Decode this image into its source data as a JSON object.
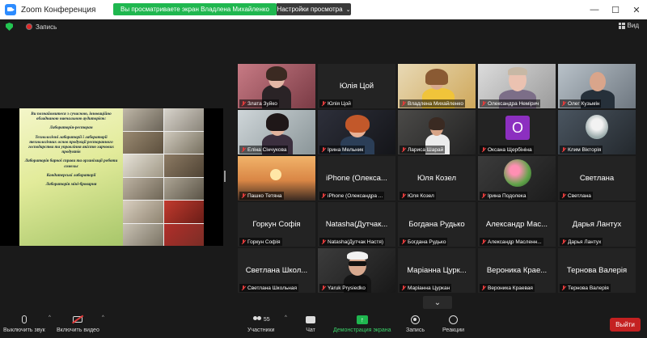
{
  "window": {
    "title": "Zoom Конференция",
    "banner": "Вы просматриваете экран Владлена Михайленко",
    "view_options": "Настройки просмотра",
    "minimize": "—",
    "maximize": "☐",
    "close": "✕"
  },
  "status": {
    "recording": "Запись",
    "view": "Вид"
  },
  "slide": {
    "lines": [
      "Ви познайомитеся з сучасною, інноваційно обладнаною навчальною аудиторією:",
      "Лабораторія-ресторан",
      "Технологічні лабораторії і лабораторії технологічних основ продукції ресторанного господарства та управління якістю харчових продуктів",
      "Лабораторія барної справи та організації роботи сомельє",
      "Кондитерські лабораторії",
      "Лабораторія міні-броварня"
    ]
  },
  "participants": [
    {
      "label": "Злата Зуйко",
      "center": "",
      "video": "girl",
      "active": true
    },
    {
      "label": "Юлія Цой",
      "center": "Юлія Цой",
      "video": ""
    },
    {
      "label": "Владлена Михайленко",
      "center": "",
      "video": "woman-yellow"
    },
    {
      "label": "Олександра Немірич",
      "center": "",
      "video": "woman-glasses"
    },
    {
      "label": "Олег Кузьмін",
      "center": "",
      "video": "man"
    },
    {
      "label": "Еліна Сінчукова",
      "center": "",
      "video": "woman-dark"
    },
    {
      "label": "Ірина Мельник",
      "center": "",
      "video": "woman-red"
    },
    {
      "label": "Лариса Шарай",
      "center": "",
      "video": "woman-room"
    },
    {
      "label": "Оксана Щербініна",
      "center": "",
      "video": "letter"
    },
    {
      "label": "Клим Вікторія",
      "center": "",
      "video": "profile"
    },
    {
      "label": "Пашко Тетяна",
      "center": "",
      "video": "sunset"
    },
    {
      "label": "iPhone (Олександра ...",
      "center": "iPhone (Олекса...",
      "video": ""
    },
    {
      "label": "Юля Козел",
      "center": "Юля Козел",
      "video": ""
    },
    {
      "label": "Ірина Подолека",
      "center": "",
      "video": "flowers"
    },
    {
      "label": "Светлана",
      "center": "Светлана",
      "video": ""
    },
    {
      "label": "Горкун Софія",
      "center": "Горкун Софія",
      "video": ""
    },
    {
      "label": "Natasha(Дутчак Настя)",
      "center": "Natasha(Дутчак...",
      "video": ""
    },
    {
      "label": "Богдана Рудько",
      "center": "Богдана Рудько",
      "video": ""
    },
    {
      "label": "Александр Масленн...",
      "center": "Александр Мас...",
      "video": ""
    },
    {
      "label": "Дарья Лантух",
      "center": "Дарья Лантух",
      "video": ""
    },
    {
      "label": "Светлана Школьная",
      "center": "Светлана Школ...",
      "video": ""
    },
    {
      "label": "Yaruk Prysiedko",
      "center": "",
      "video": "sunglasses"
    },
    {
      "label": "Маріанна Цуркан",
      "center": "Маріанна Цурк...",
      "video": ""
    },
    {
      "label": "Вероника Краевая",
      "center": "Вероника Крае...",
      "video": ""
    },
    {
      "label": "Тернова Валерія",
      "center": "Тернова Валерія",
      "video": ""
    }
  ],
  "avatar_letter": "O",
  "toolbar": {
    "mute": "Выключить звук",
    "video": "Включить видео",
    "participants": "Участники",
    "participants_count": "55",
    "chat": "Чат",
    "share": "Демонстрация экрана",
    "record": "Запись",
    "reactions": "Реакции",
    "leave": "Выйти"
  },
  "colors": {
    "banner_green": "#1fb74f",
    "active_border": "#b8e24a",
    "leave_red": "#c42121",
    "mic_off_red": "#e23b3b"
  }
}
